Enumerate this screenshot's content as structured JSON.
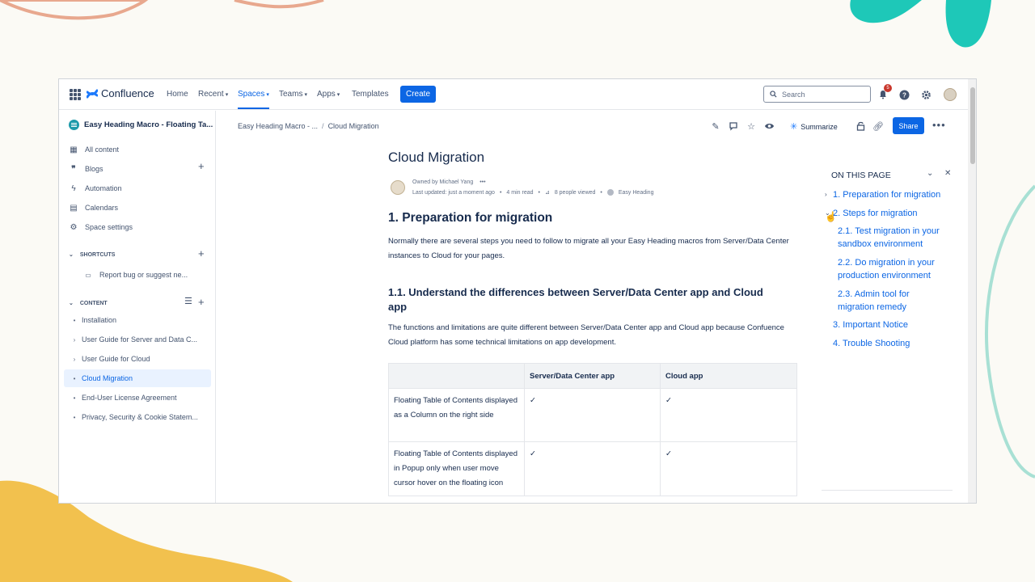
{
  "colors": {
    "accent": "#0c66e4",
    "brand": "#1d7afc",
    "selected_bg": "#e9f2ff",
    "deco_teal": "#1ec8b8",
    "deco_yellow": "#f2c14e",
    "deco_salmon": "#e8a88e"
  },
  "topnav": {
    "app_name": "Confluence",
    "items": [
      {
        "label": "Home",
        "icon": ""
      },
      {
        "label": "Recent",
        "icon": "chevron-down-icon"
      },
      {
        "label": "Spaces",
        "icon": "chevron-down-icon"
      },
      {
        "label": "Teams",
        "icon": "chevron-down-icon"
      },
      {
        "label": "Apps",
        "icon": "chevron-down-icon"
      },
      {
        "label": "Templates",
        "icon": ""
      }
    ],
    "create_label": "Create",
    "search_placeholder": "Search",
    "notification_count": "5"
  },
  "sidebar": {
    "space_name": "Easy Heading Macro - Floating Ta...",
    "items": [
      {
        "label": "All content",
        "icon": "all-content-icon"
      },
      {
        "label": "Blogs",
        "icon": "quote-icon"
      },
      {
        "label": "Automation",
        "icon": "lightning-icon"
      },
      {
        "label": "Calendars",
        "icon": "calendar-icon"
      },
      {
        "label": "Space settings",
        "icon": "gear-icon"
      }
    ],
    "shortcuts_title": "SHORTCUTS",
    "shortcut": "Report bug or suggest ne...",
    "content_title": "CONTENT",
    "tree": [
      {
        "label": "Installation",
        "marker": "•"
      },
      {
        "label": "User Guide for Server and Data C...",
        "marker": "›"
      },
      {
        "label": "User Guide for Cloud",
        "marker": "›"
      },
      {
        "label": "Cloud Migration",
        "marker": "•"
      },
      {
        "label": "End-User License Agreement",
        "marker": "•"
      },
      {
        "label": "Privacy, Security & Cookie Statem...",
        "marker": "•"
      }
    ],
    "selected": "Cloud Migration"
  },
  "header": {
    "breadcrumb": [
      "Easy Heading Macro - ...",
      "Cloud Migration"
    ],
    "summarize_label": "Summarize",
    "share_label": "Share"
  },
  "page": {
    "title": "Cloud Migration",
    "owned_by": "Owned by Michael Yang",
    "last_updated": "Last updated: just a moment ago",
    "read_time": "4 min read",
    "people_viewed": "8 people viewed",
    "app_tag": "Easy Heading",
    "h1": "1. Preparation for migration",
    "p1": "Normally there are several steps you need to follow to migrate all your Easy Heading macros from Server/Data Center instances to Cloud for your pages.",
    "h2": "1.1. Understand the differences between Server/Data Center app and Cloud app",
    "p2": "The functions and limitations are quite different between Server/Data Center app and Cloud app because Confuence Cloud platform has some technical limitations on app development.",
    "table": {
      "headers": [
        "",
        "Server/Data Center app",
        "Cloud app"
      ],
      "rows": [
        [
          "Floating Table of Contents displayed as a Column on the right side",
          "✓",
          "✓"
        ],
        [
          "Floating Table of Contents displayed in Popup only when user move cursor hover on the floating icon",
          "✓",
          "✓"
        ]
      ]
    }
  },
  "toc": {
    "title": "ON THIS PAGE",
    "items": [
      "1. Preparation for migration",
      "2. Steps for migration",
      "2.1. Test migration in your sandbox environment",
      "2.2. Do migration in your production environment",
      "2.3. Admin tool for migration remedy",
      "3. Important Notice",
      "4. Trouble Shooting"
    ]
  }
}
